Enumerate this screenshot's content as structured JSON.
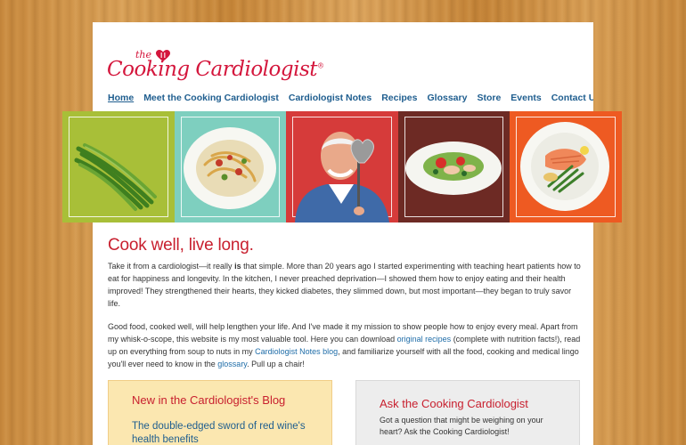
{
  "brand": {
    "logo_small": "the",
    "logo_main": "Cooking Cardiologist",
    "trademark": "®",
    "accent_color": "#d4163c"
  },
  "nav": {
    "items": [
      {
        "label": "Home",
        "active": true
      },
      {
        "label": "Meet the Cooking Cardiologist",
        "active": false
      },
      {
        "label": "Cardiologist Notes",
        "active": false
      },
      {
        "label": "Recipes",
        "active": false
      },
      {
        "label": "Glossary",
        "active": false
      },
      {
        "label": "Store",
        "active": false
      },
      {
        "label": "Events",
        "active": false
      },
      {
        "label": "Contact Us",
        "active": false
      }
    ]
  },
  "banner": {
    "panels": [
      {
        "icon": "green-beans-icon",
        "color": "#a8bf38"
      },
      {
        "icon": "pasta-plate-icon",
        "color": "#7ecfbf"
      },
      {
        "icon": "chef-with-heart-spatula-icon",
        "color": "#d63b3a"
      },
      {
        "icon": "salad-plate-icon",
        "color": "#6d2a24"
      },
      {
        "icon": "salmon-plate-icon",
        "color": "#ee5a22"
      }
    ]
  },
  "main": {
    "headline": "Cook well, live long.",
    "p1_a": "Take it from a cardiologist—it really ",
    "p1_bold": "is",
    "p1_b": " that simple. More than 20 years ago I started experimenting with teaching heart patients how to eat for happiness and longevity. In the kitchen, I never preached deprivation—I showed them how to enjoy eating and their health improved! They strengthened their hearts, they kicked diabetes, they slimmed down, but most important—they began to truly savor life.",
    "p2_a": "Good food, cooked well, will help lengthen your life. And I've made it my mission to show people how to enjoy every meal. Apart from my whisk-o-scope, this website is my most valuable tool. Here you can download ",
    "p2_link1": "original recipes",
    "p2_b": " (complete with nutrition facts!), read up on everything from soup to nuts in my ",
    "p2_link2": "Cardiologist Notes blog",
    "p2_c": ", and familiarize yourself with all the food, cooking and medical lingo you'll ever need to know in the ",
    "p2_link3": "glossary",
    "p2_d": ". Pull up a chair!"
  },
  "blog_box": {
    "title": "New in the Cardiologist's Blog",
    "post_title": "The double-edged sword of red wine's health benefits"
  },
  "ask_box": {
    "title": "Ask the Cooking Cardiologist",
    "text": "Got a question that might be weighing on your heart? Ask the Cooking Cardiologist!"
  }
}
